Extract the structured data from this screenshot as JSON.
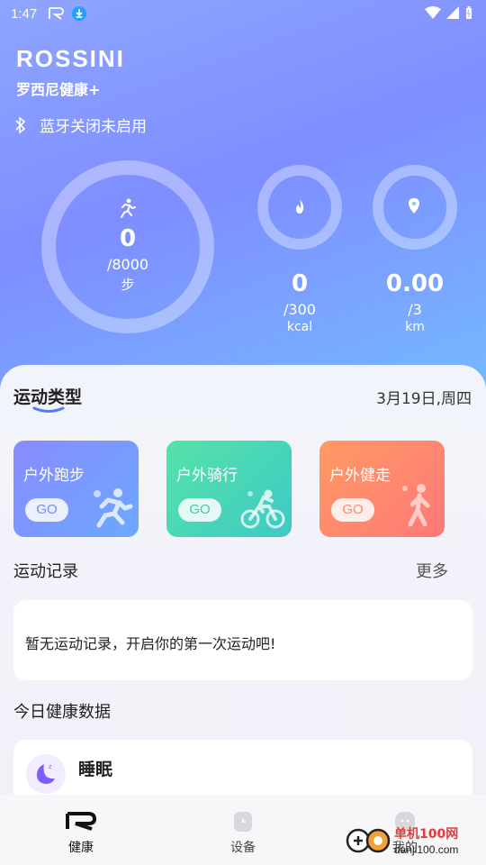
{
  "status_bar": {
    "time": "1:47"
  },
  "brand": {
    "logo": "ROSSINI",
    "subtitle": "罗西尼健康+"
  },
  "bluetooth": {
    "text": "蓝牙关闭未启用"
  },
  "metrics": {
    "steps": {
      "value": "0",
      "goal": "/8000",
      "unit": "步",
      "progress": 0
    },
    "calories": {
      "value": "0",
      "goal": "/300",
      "unit": "kcal",
      "progress": 0
    },
    "distance": {
      "value": "0.00",
      "goal": "/3",
      "unit": "km",
      "progress": 0
    }
  },
  "exercise": {
    "title": "运动类型",
    "date": "3月19日,周四",
    "cards": [
      {
        "label": "户外跑步",
        "go": "GO",
        "color_from": "#8a8bff",
        "color_to": "#6aa8ff"
      },
      {
        "label": "户外骑行",
        "go": "GO",
        "color_from": "#55e3a8",
        "color_to": "#3ec9c6"
      },
      {
        "label": "户外健走",
        "go": "GO",
        "color_from": "#ff9a63",
        "color_to": "#ff7878"
      }
    ]
  },
  "records": {
    "title": "运动记录",
    "more": "更多",
    "empty_text": "暂无运动记录，开启你的第一次运动吧!"
  },
  "health": {
    "title": "今日健康数据",
    "sleep": "睡眠"
  },
  "nav": {
    "items": [
      {
        "label": "健康",
        "active": true
      },
      {
        "label": "设备",
        "active": false
      },
      {
        "label": "我的",
        "active": false
      }
    ]
  },
  "watermark": {
    "text": "单机100网",
    "url": "danji100.com"
  }
}
